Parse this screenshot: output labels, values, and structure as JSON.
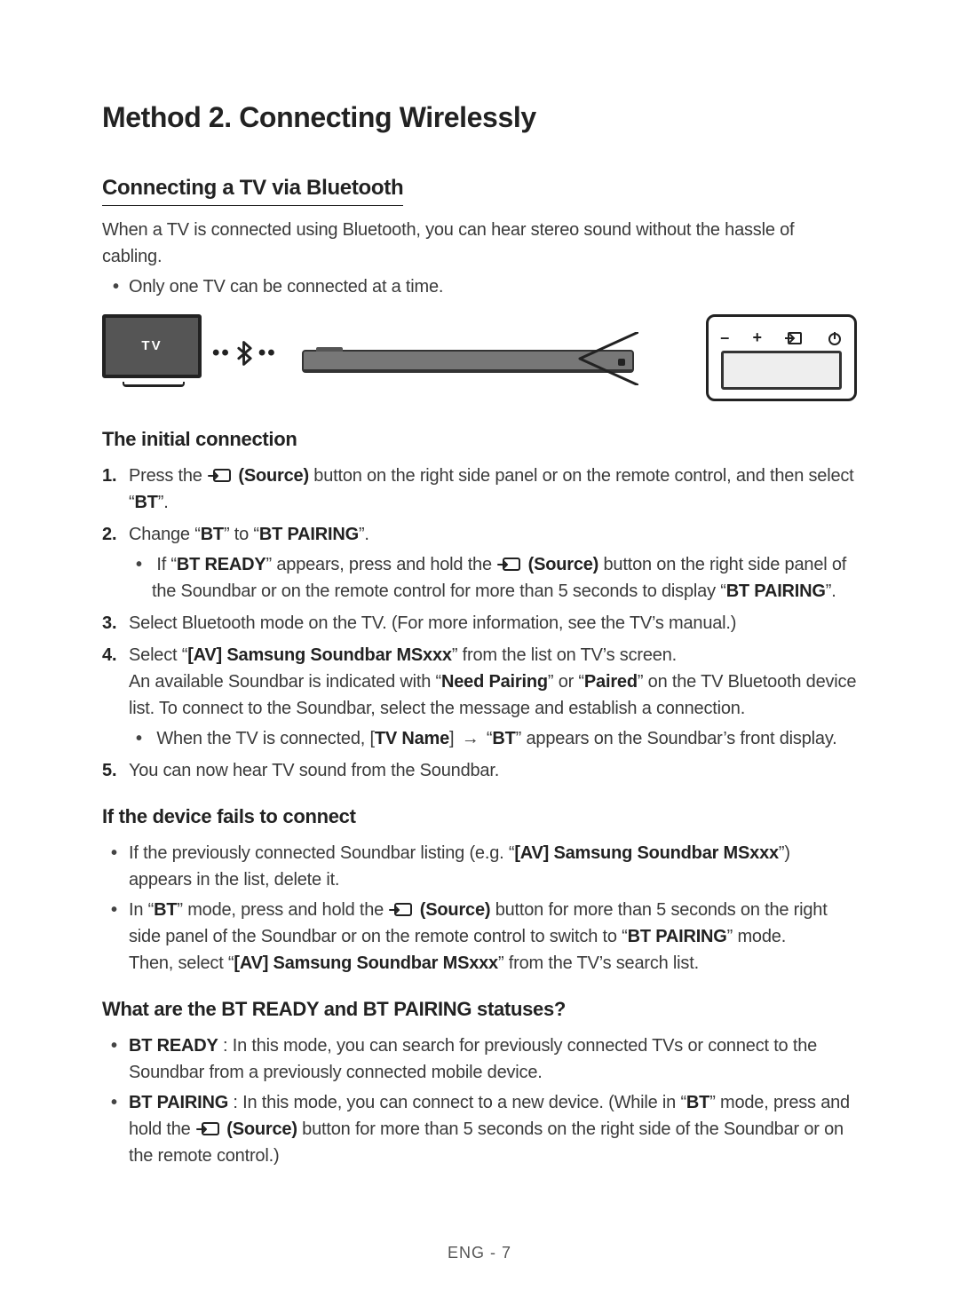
{
  "title": "Method 2. Connecting Wirelessly",
  "section1": {
    "heading": "Connecting a TV via Bluetooth",
    "intro": "When a TV is connected using Bluetooth, you can hear stereo sound without the hassle of cabling.",
    "note": "Only one TV can be connected at a time."
  },
  "diagram": {
    "tv_label": "TV",
    "panel_minus": "–",
    "panel_plus": "+"
  },
  "initial": {
    "heading": "The initial connection",
    "step1_a": "Press the ",
    "step1_b": " (Source)",
    "step1_c": " button on the right side panel or on the remote control, and then select “",
    "step1_bt": "BT",
    "step1_d": "”.",
    "step2_a": "Change “",
    "step2_bt": "BT",
    "step2_b": "” to “",
    "step2_pair": "BT PAIRING",
    "step2_c": "”.",
    "step2_sub_a": "If “",
    "step2_sub_ready": "BT READY",
    "step2_sub_b": "” appears, press and hold the ",
    "step2_sub_src": " (Source)",
    "step2_sub_c": " button on the right side panel of the Soundbar or on the remote control for more than 5 seconds to display “",
    "step2_sub_pair": "BT PAIRING",
    "step2_sub_d": "”.",
    "step3": "Select Bluetooth mode on the TV. (For more information, see the TV’s manual.)",
    "step4_a": "Select “",
    "step4_name": "[AV] Samsung Soundbar MSxxx",
    "step4_b": "” from the list on TV’s screen.",
    "step4_line2_a": "An available Soundbar is indicated with “",
    "step4_need": "Need Pairing",
    "step4_line2_b": "” or “",
    "step4_paired": "Paired",
    "step4_line2_c": "” on the TV Bluetooth device list. To connect to the Soundbar, select the message and establish a connection.",
    "step4_sub_a": "When the TV is connected, [",
    "step4_sub_tvname": "TV Name",
    "step4_sub_b": "] ",
    "step4_sub_arrow": "→",
    "step4_sub_c": " “",
    "step4_sub_bt": "BT",
    "step4_sub_d": "” appears on the Soundbar’s front display.",
    "step5": "You can now hear TV sound from the Soundbar."
  },
  "fails": {
    "heading": "If the device fails to connect",
    "b1_a": "If the previously connected Soundbar listing (e.g. “",
    "b1_name": "[AV] Samsung Soundbar MSxxx",
    "b1_b": "”) appears in the list, delete it.",
    "b2_a": "In “",
    "b2_bt": "BT",
    "b2_b": "” mode, press and hold the ",
    "b2_src": " (Source)",
    "b2_c": " button for more than 5 seconds on the right side panel of the Soundbar or on the remote control to switch to “",
    "b2_pair": "BT PAIRING",
    "b2_d": "” mode.",
    "b2_line2_a": "Then, select “",
    "b2_line2_name": "[AV] Samsung Soundbar MSxxx",
    "b2_line2_b": "” from the TV’s search list."
  },
  "status": {
    "heading": "What are the BT READY and BT PAIRING statuses?",
    "b1_label": "BT READY",
    "b1_text": " : In this mode, you can search for previously connected TVs or connect to the Soundbar from a previously connected mobile device.",
    "b2_label": "BT PAIRING",
    "b2_a": " : In this mode, you can connect to a new device. (While in “",
    "b2_bt": "BT",
    "b2_b": "” mode, press and hold the ",
    "b2_src": " (Source)",
    "b2_c": " button for more than 5 seconds on the right side of the Soundbar or on the remote control.)"
  },
  "footer": "ENG - 7"
}
